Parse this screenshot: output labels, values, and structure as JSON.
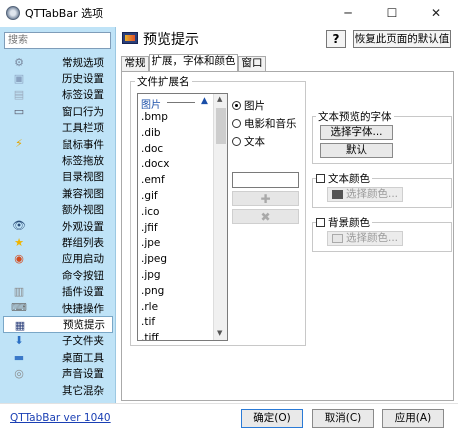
{
  "window": {
    "title": "QTTabBar 选项",
    "minimize": "─",
    "maximize": "☐",
    "close": "✕"
  },
  "sidebar": {
    "search_placeholder": "搜索",
    "items": [
      {
        "label": "常规选项",
        "icon": "gear-icon",
        "glyph": "⚙",
        "color": "#7a8aa0"
      },
      {
        "label": "历史设置",
        "icon": "history-icon",
        "glyph": "▣",
        "color": "#8aa2c0"
      },
      {
        "label": "标签设置",
        "icon": "tab-icon",
        "glyph": "▤",
        "color": "#9aa9bc"
      },
      {
        "label": "窗口行为",
        "icon": "window-icon",
        "glyph": "▭",
        "color": "#556"
      },
      {
        "label": "工具栏项",
        "icon": "toolbar-icon",
        "glyph": "",
        "color": "#556"
      },
      {
        "label": "鼠标事件",
        "icon": "lightning-icon",
        "glyph": "⚡",
        "color": "#e2a400"
      },
      {
        "label": "标签拖放",
        "icon": "drag-icon",
        "glyph": "",
        "color": "#556"
      },
      {
        "label": "目录视图",
        "icon": "folder-view-icon",
        "glyph": "",
        "color": "#556"
      },
      {
        "label": "兼容视图",
        "icon": "compat-icon",
        "glyph": "",
        "color": "#556"
      },
      {
        "label": "额外视图",
        "icon": "extra-view-icon",
        "glyph": "",
        "color": "#556"
      },
      {
        "label": "外观设置",
        "icon": "eye-icon",
        "glyph": "👁",
        "color": "#2b4f7a"
      },
      {
        "label": "群组列表",
        "icon": "star-icon",
        "glyph": "★",
        "color": "#f0b400"
      },
      {
        "label": "应用启动",
        "icon": "app-launch-icon",
        "glyph": "◉",
        "color": "#d24b1f"
      },
      {
        "label": "命令按钮",
        "icon": "command-icon",
        "glyph": "",
        "color": "#556"
      },
      {
        "label": "插件设置",
        "icon": "plugin-icon",
        "glyph": "▥",
        "color": "#8a8a8a"
      },
      {
        "label": "快捷操作",
        "icon": "keyboard-icon",
        "glyph": "⌨",
        "color": "#6a6a6a"
      },
      {
        "label": "预览提示",
        "icon": "preview-icon",
        "glyph": "▦",
        "color": "#2b3f7a"
      },
      {
        "label": "子文件夹",
        "icon": "subfolder-icon",
        "glyph": "⬇",
        "color": "#2a6fc4"
      },
      {
        "label": "桌面工具",
        "icon": "desktop-icon",
        "glyph": "▬",
        "color": "#3a78c8"
      },
      {
        "label": "声音设置",
        "icon": "sound-icon",
        "glyph": "◎",
        "color": "#8a8a8a"
      },
      {
        "label": "其它混杂",
        "icon": "misc-icon",
        "glyph": "",
        "color": "#556"
      }
    ],
    "selected_index": 16
  },
  "main": {
    "title": "预览提示",
    "help_label": "?",
    "reset_label": "恢复此页面的默认值",
    "tabs": [
      {
        "label": "常规"
      },
      {
        "label": "扩展，字体和颜色"
      },
      {
        "label": "窗口"
      }
    ],
    "active_tab": 1,
    "ext_group": {
      "label": "文件扩展名",
      "list_header": "图片",
      "items": [
        ".bmp",
        ".dib",
        ".doc",
        ".docx",
        ".emf",
        ".gif",
        ".ico",
        ".jfif",
        ".jpe",
        ".jpeg",
        ".jpg",
        ".png",
        ".rle",
        ".tif",
        ".tiff"
      ],
      "radios": [
        {
          "label": "图片",
          "checked": true
        },
        {
          "label": "电影和音乐",
          "checked": false
        },
        {
          "label": "文本",
          "checked": false
        }
      ],
      "input_value": "",
      "add_icon": "add-icon",
      "delete_icon": "delete-icon"
    },
    "font_group": {
      "label": "文本预览的字体",
      "choose_font": "选择字体...",
      "default": "默认"
    },
    "text_color": {
      "label": "文本颜色",
      "checked": false,
      "choose_color": "选择颜色...",
      "swatch": "#555555"
    },
    "bg_color": {
      "label": "背景颜色",
      "checked": false,
      "choose_color": "选择颜色...",
      "swatch": "#e6e6e6"
    }
  },
  "footer": {
    "version": "QTTabBar ver 1040",
    "ok": "确定(O)",
    "cancel": "取消(C)",
    "apply": "应用(A)"
  }
}
